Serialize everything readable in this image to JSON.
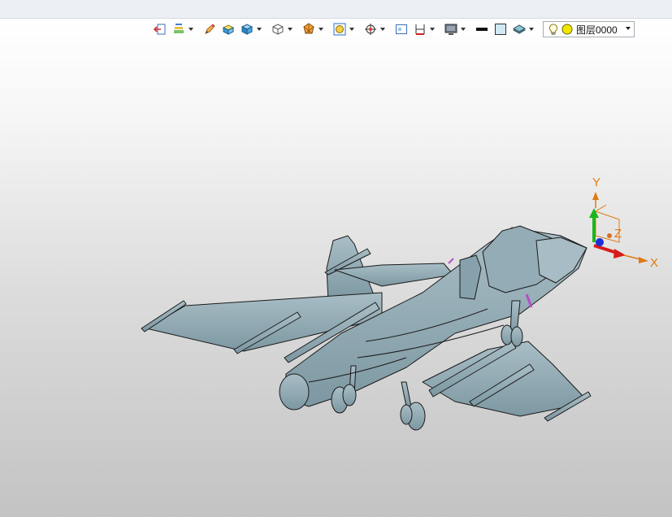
{
  "toolbar": {
    "items": [
      {
        "icon": "exit-sketch-icon",
        "has_dropdown": false
      },
      {
        "icon": "layer-style-icon",
        "has_dropdown": true
      },
      {
        "icon": "pencil-edit-icon",
        "has_dropdown": false
      },
      {
        "icon": "shaded-display-icon",
        "has_dropdown": false
      },
      {
        "icon": "solid-box-icon",
        "has_dropdown": true
      },
      {
        "icon": "wireframe-cube-icon",
        "has_dropdown": true
      },
      {
        "icon": "render-mode-icon",
        "has_dropdown": true
      },
      {
        "icon": "zoom-fit-icon",
        "has_dropdown": true
      },
      {
        "icon": "snap-target-icon",
        "has_dropdown": true
      },
      {
        "icon": "view-window-icon",
        "has_dropdown": false
      },
      {
        "icon": "dimension-icon",
        "has_dropdown": true
      },
      {
        "icon": "background-color-icon",
        "has_dropdown": true
      },
      {
        "icon": "line-weight-icon",
        "has_dropdown": false
      },
      {
        "icon": "fill-color-icon",
        "has_dropdown": false
      },
      {
        "icon": "layer-stack-icon",
        "has_dropdown": true
      }
    ]
  },
  "layer": {
    "current": "图层0000",
    "bulb_icon": "lightbulb-icon",
    "color_icon": "layer-color-icon",
    "color": "#f2e600"
  },
  "triad": {
    "x_label": "X",
    "y_label": "Y",
    "z_label": "Z",
    "x_color": "#d81b1b",
    "y_color": "#1db51d",
    "z_color": "#1a2fd6",
    "label_color": "#e07a12"
  },
  "model": {
    "body_color": "#8fa7b0",
    "edge_color": "#1a1a1a"
  }
}
